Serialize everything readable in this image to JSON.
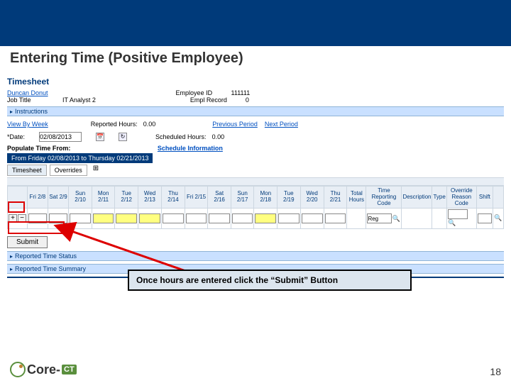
{
  "slide": {
    "title": "Entering Time (Positive Employee)",
    "page_number": "18"
  },
  "timesheet": {
    "heading": "Timesheet",
    "employee_name": "Duncan Donut",
    "employee_id_label": "Employee ID",
    "employee_id": "111111",
    "job_title_label": "Job Title",
    "job_title": "IT Analyst 2",
    "empl_record_label": "Empl Record",
    "empl_record": "0",
    "instructions_label": "Instructions",
    "view_by_label": "View By",
    "view_by_value": "Week",
    "date_label": "*Date:",
    "date_value": "02/08/2013",
    "reported_hours_label": "Reported Hours:",
    "reported_hours": "0.00",
    "scheduled_hours_label": "Scheduled Hours:",
    "scheduled_hours": "0.00",
    "previous_period": "Previous Period",
    "next_period": "Next Period",
    "populate_label": "Populate Time From:",
    "schedule_info": "Schedule Information",
    "period_range": "From Friday 02/08/2013 to Thursday 02/21/2013",
    "tabs": {
      "timesheet": "Timesheet",
      "overrides": "Overrides"
    },
    "columns": [
      "Fri 2/8",
      "Sat 2/9",
      "Sun 2/10",
      "Mon 2/11",
      "Tue 2/12",
      "Wed 2/13",
      "Thu 2/14",
      "Fri 2/15",
      "Sat 2/16",
      "Sun 2/17",
      "Mon 2/18",
      "Tue 2/19",
      "Wed 2/20",
      "Thu 2/21",
      "Total Hours",
      "Time Reporting Code",
      "Description",
      "Type",
      "Override Reason Code",
      "Shift"
    ],
    "trc_value": "Reg",
    "submit_label": "Submit",
    "status_label": "Reported Time Status",
    "summary_label": "Reported Time Summary"
  },
  "callout": {
    "text": "Once hours are entered click the “Submit” Button"
  },
  "logo_text": "Core-"
}
